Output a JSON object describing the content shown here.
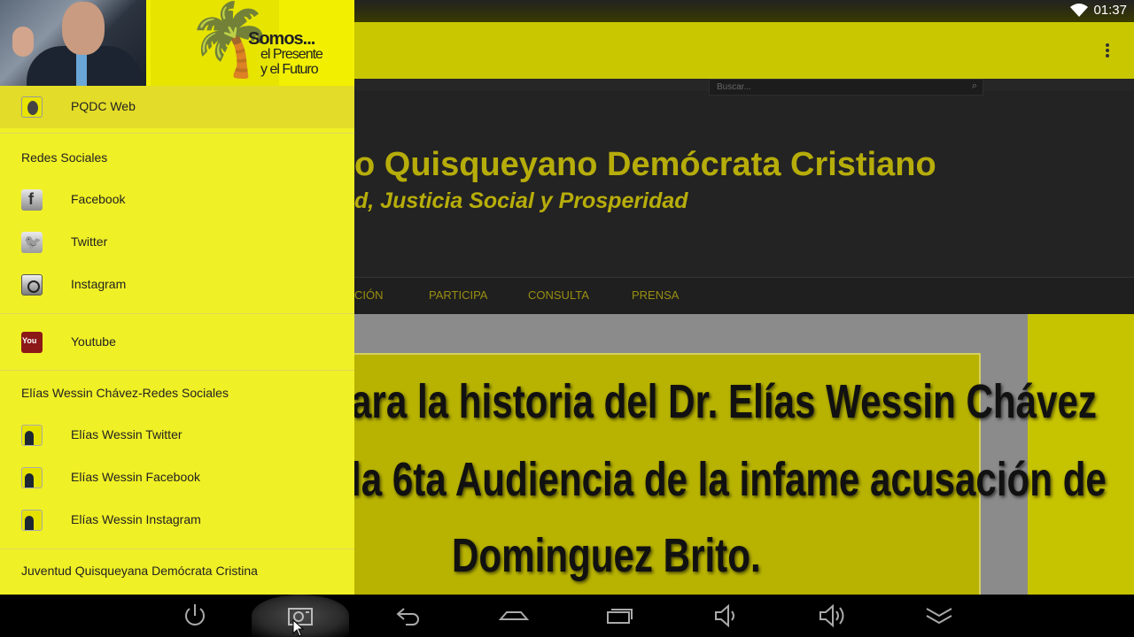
{
  "status_bar": {
    "time": "01:37",
    "wifi_icon": "wifi-icon"
  },
  "app_bar": {
    "menu_icon": "overflow-menu-icon"
  },
  "web": {
    "search_placeholder": "Buscar...",
    "site_title": "o Quisqueyano Demócrata Cristiano",
    "site_tagline": "d, Justicia Social y Prosperidad",
    "nav": [
      "CIÓN",
      "PARTICIPA",
      "CONSULTA",
      "PRENSA"
    ],
    "banner_lines": [
      "ara la historia del Dr. Elías Wessin Chávez",
      " la 6ta Audiencia de la infame acusación de",
      "Dominguez Brito."
    ]
  },
  "drawer": {
    "header": {
      "line1": "Somos...",
      "line2": "el Presente",
      "line3": "y el Futuro"
    },
    "active_item": {
      "label": "PQDC Web",
      "icon": "pqdc-logo-icon"
    },
    "sections": [
      {
        "title": "Redes Sociales",
        "items": [
          {
            "label": "Facebook",
            "icon": "facebook-icon"
          },
          {
            "label": "Twitter",
            "icon": "twitter-icon"
          },
          {
            "label": "Instagram",
            "icon": "instagram-icon"
          },
          {
            "label": "Youtube",
            "icon": "youtube-icon"
          }
        ]
      },
      {
        "title": "Elías Wessin Chávez-Redes Sociales",
        "items": [
          {
            "label": "Elías Wessin Twitter",
            "icon": "elias-wessin-avatar-icon"
          },
          {
            "label": "Elías Wessin Facebook",
            "icon": "elias-wessin-avatar-icon"
          },
          {
            "label": "Elías Wessin Instagram",
            "icon": "elias-wessin-avatar-icon"
          }
        ]
      },
      {
        "title": "Juventud Quisqueyana Demócrata Cristina",
        "items": []
      }
    ]
  },
  "nav_bar": {
    "buttons": [
      "power-icon",
      "screenshot-icon",
      "back-icon",
      "home-icon",
      "recents-icon",
      "volume-down-icon",
      "volume-up-icon",
      "collapse-icon"
    ]
  }
}
